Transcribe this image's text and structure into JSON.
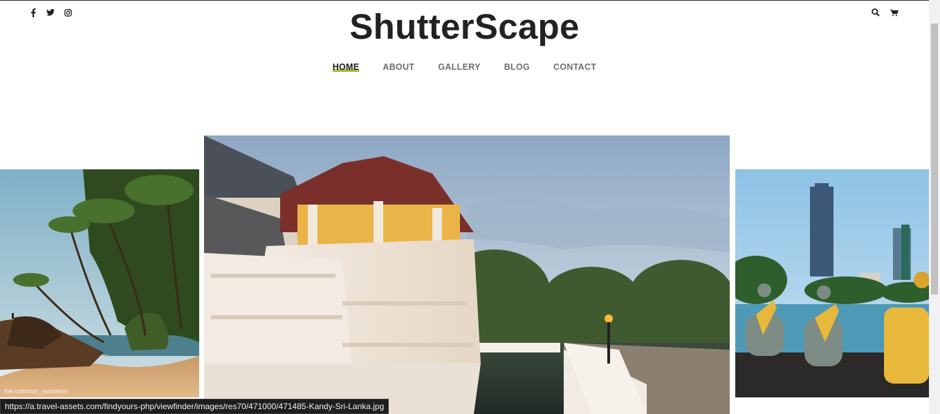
{
  "site": {
    "logo": "ShutterScape"
  },
  "social_icons": [
    "facebook-icon",
    "twitter-icon",
    "instagram-icon"
  ],
  "tool_icons": [
    "search-icon",
    "cart-icon"
  ],
  "nav": {
    "items": [
      {
        "label": "HOME",
        "active": true
      },
      {
        "label": "ABOUT",
        "active": false
      },
      {
        "label": "GALLERY",
        "active": false
      },
      {
        "label": "BLOG",
        "active": false
      },
      {
        "label": "CONTACT",
        "active": false
      }
    ]
  },
  "slider": {
    "left_watermark": "the common_wanderer",
    "slides": [
      "beach-palm-photo",
      "kandy-temple-photo",
      "colombo-buddha-photo"
    ]
  },
  "status_bar": {
    "url": "https://a.travel-assets.com/findyours-php/viewfinder/images/res70/471000/471485-Kandy-Sri-Lanka.jpg"
  },
  "colors": {
    "accent": "#9bc23c",
    "logo": "#222222",
    "nav": "#6e6e6e"
  }
}
